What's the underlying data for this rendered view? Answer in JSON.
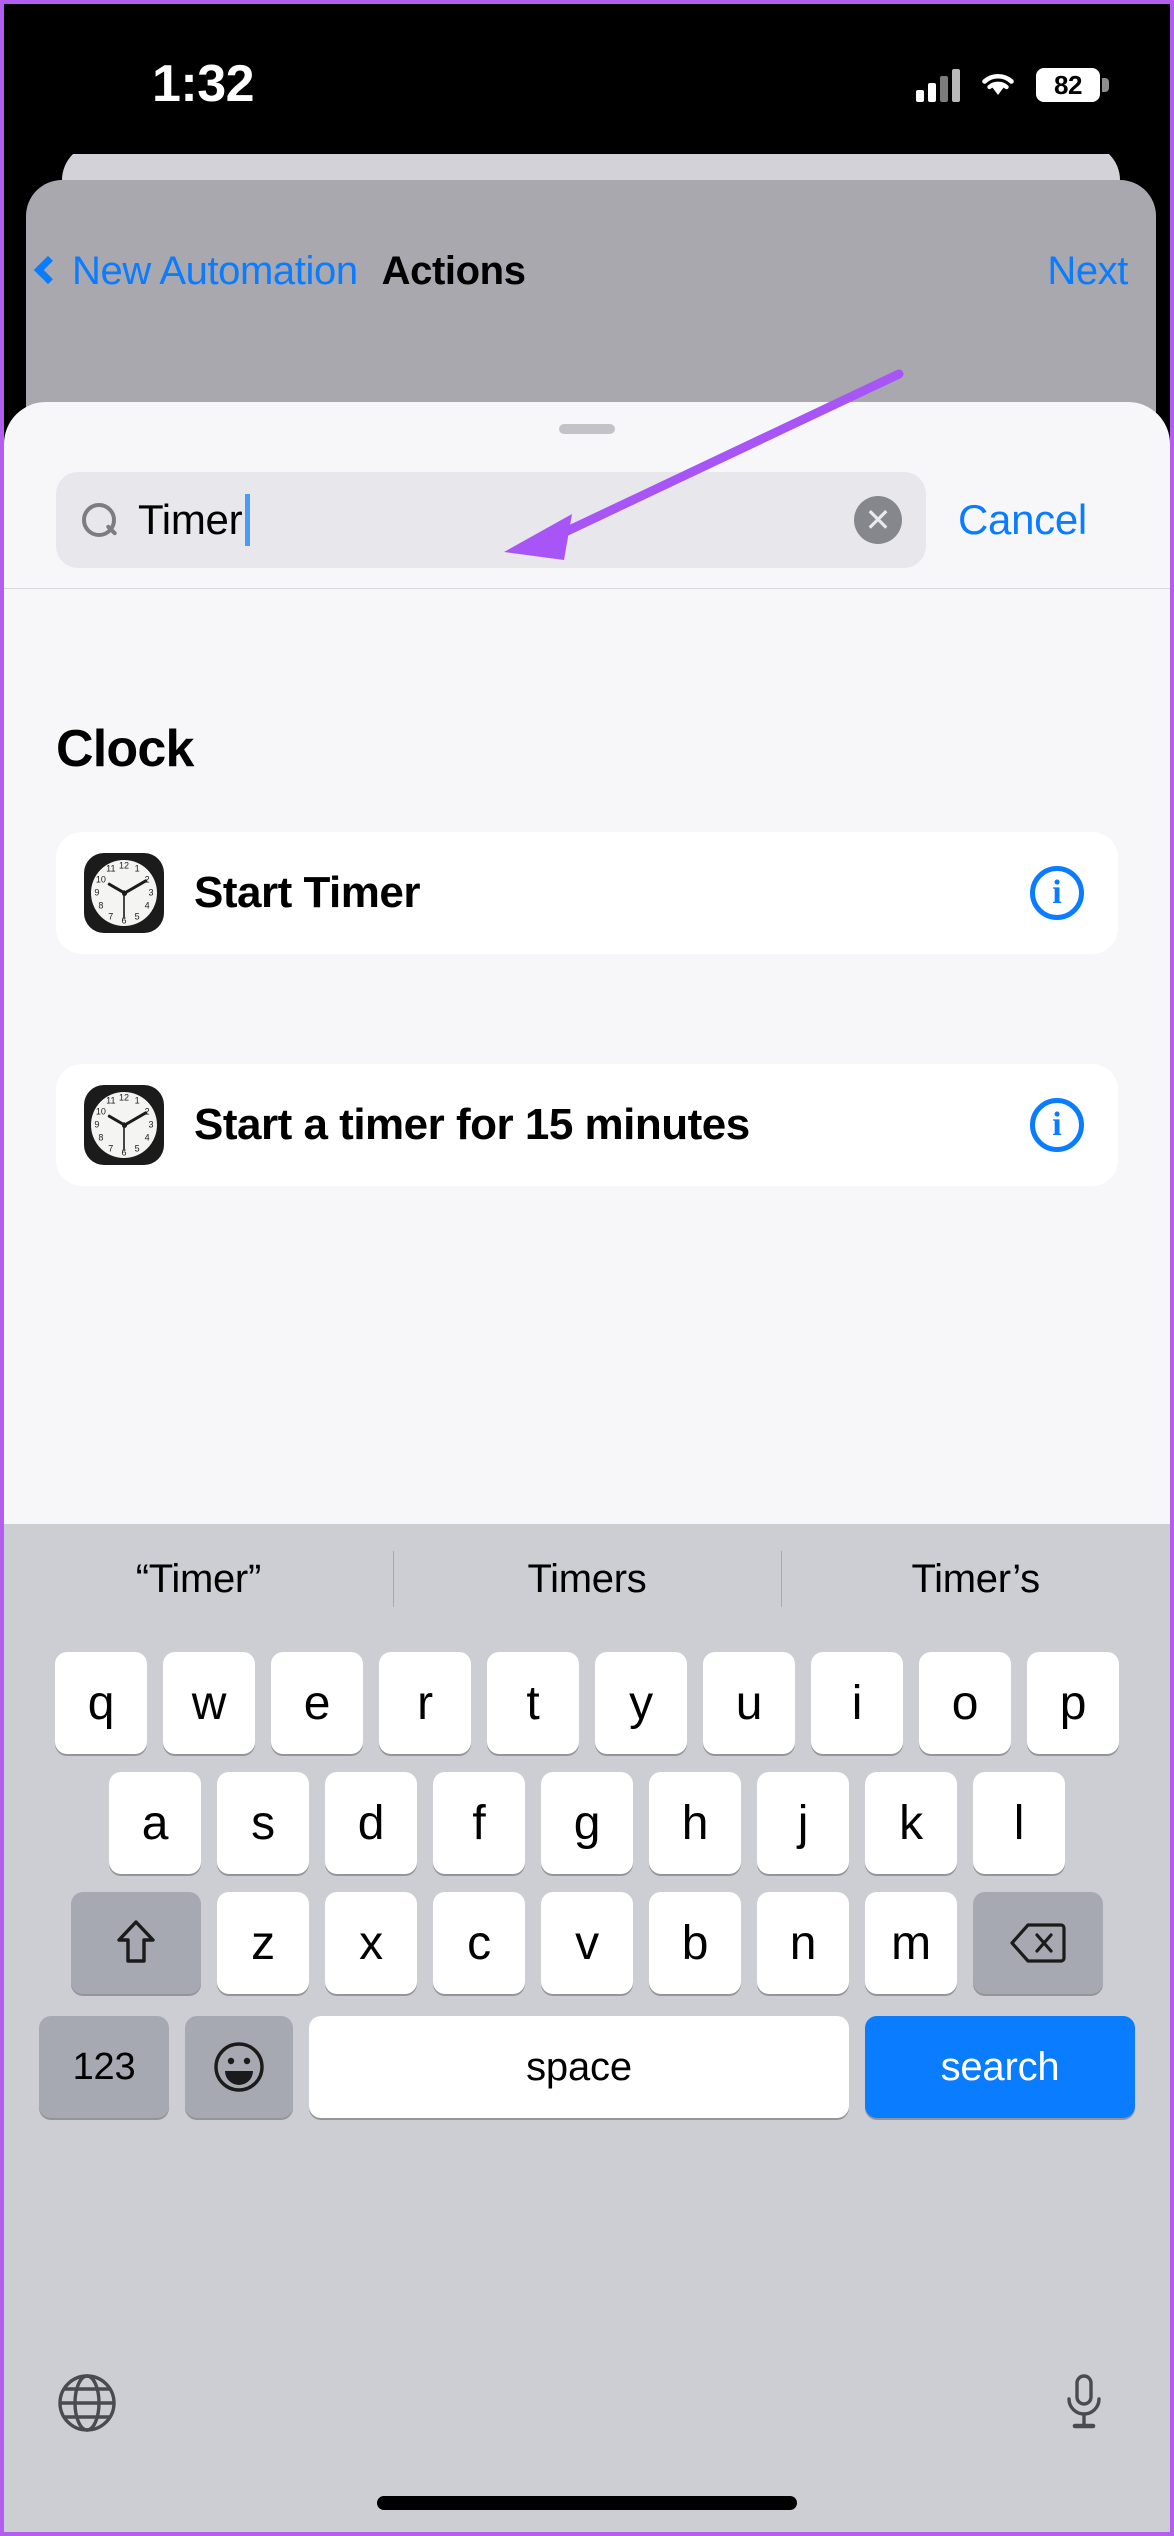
{
  "status_bar": {
    "time": "1:32",
    "battery_percent": "82",
    "signal_icon": "cellular-bars-icon",
    "wifi_icon": "wifi-icon",
    "battery_icon": "battery-icon"
  },
  "nav_bar": {
    "back_label": "New Automation",
    "back_icon": "chevron-left-icon",
    "title": "Actions",
    "next_label": "Next"
  },
  "search": {
    "value": "Timer",
    "placeholder": "Search",
    "search_icon": "magnifying-glass-icon",
    "clear_icon": "clear-circle-icon",
    "clear_glyph": "✕",
    "cancel_label": "Cancel",
    "grabber": "sheet-grabber"
  },
  "results": {
    "section_title": "Clock",
    "items": [
      {
        "label": "Start Timer",
        "app_icon": "clock-app-icon",
        "info_icon": "info-circle-icon",
        "info_glyph": "i"
      },
      {
        "label": "Start a timer for 15 minutes",
        "app_icon": "clock-app-icon",
        "info_icon": "info-circle-icon",
        "info_glyph": "i"
      }
    ]
  },
  "annotation": {
    "arrow_color": "#a855f7",
    "arrow_name": "purple-pointer-arrow"
  },
  "keyboard": {
    "suggestions": [
      "“Timer”",
      "Timers",
      "Timer’s"
    ],
    "row1": [
      "q",
      "w",
      "e",
      "r",
      "t",
      "y",
      "u",
      "i",
      "o",
      "p"
    ],
    "row2": [
      "a",
      "s",
      "d",
      "f",
      "g",
      "h",
      "j",
      "k",
      "l"
    ],
    "row3": [
      "z",
      "x",
      "c",
      "v",
      "b",
      "n",
      "m"
    ],
    "shift_icon": "shift-arrow-icon",
    "delete_icon": "delete-backward-icon",
    "numbers_label": "123",
    "emoji_icon": "emoji-smiley-icon",
    "emoji_glyph": "☺",
    "space_label": "space",
    "search_label": "search",
    "globe_icon": "globe-icon",
    "mic_icon": "microphone-icon"
  },
  "colors": {
    "accent_blue": "#0a7cff",
    "keyboard_bg": "#cdced4",
    "sheet_bg": "#f7f7f9",
    "dimmed_sheet": "#a8a8ae"
  }
}
